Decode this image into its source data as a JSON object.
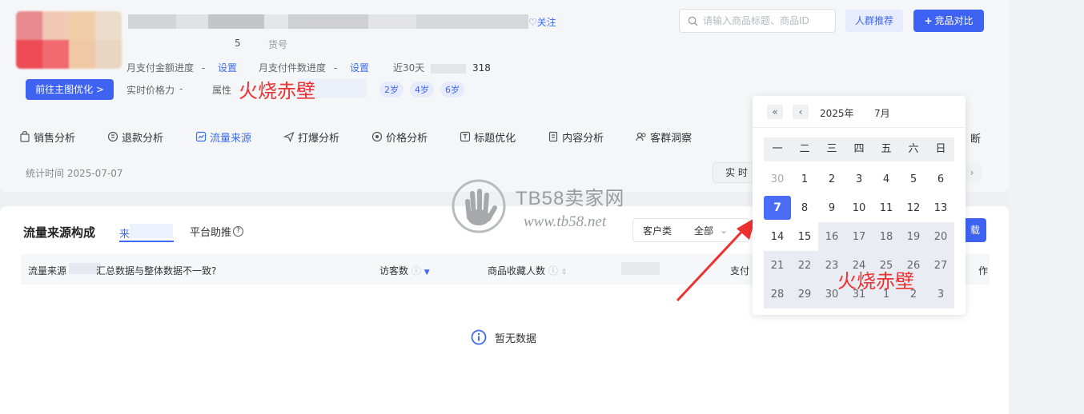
{
  "header": {
    "follow_label": "关注",
    "shop_suffix_num": "5",
    "shop_suffix_label": "货号",
    "optimize_button": "前往主图优化 >",
    "stats": [
      {
        "label": "月支付金额进度",
        "sep": "-",
        "link": "设置"
      },
      {
        "label": "月支付件数进度",
        "sep": "-",
        "link": "设置"
      },
      {
        "label": "近30天",
        "value": "318"
      }
    ],
    "price_label": "实时价格力",
    "price_sep": "-",
    "attr_label": "属性",
    "ages": [
      "2岁",
      "4岁",
      "6岁"
    ]
  },
  "search": {
    "placeholder": "请输入商品标题、商品ID"
  },
  "toolbar": {
    "crowd_button": "人群推荐",
    "compare_button": "竞品对比"
  },
  "tabs": [
    {
      "label": "销售分析",
      "icon": "bag-icon"
    },
    {
      "label": "退款分析",
      "icon": "refund-icon"
    },
    {
      "label": "流量来源",
      "icon": "trend-icon",
      "active": true
    },
    {
      "label": "打爆分析",
      "icon": "send-icon"
    },
    {
      "label": "价格分析",
      "icon": "price-icon"
    },
    {
      "label": "标题优化",
      "icon": "title-icon"
    },
    {
      "label": "内容分析",
      "icon": "doc-icon"
    },
    {
      "label": "客群洞察",
      "icon": "users-icon"
    }
  ],
  "tab_overflow_fragment": "断",
  "stat_time": "统计时间 2025-07-07",
  "realtime_label": "实 时",
  "section": {
    "title": "流量来源构成",
    "tab_source": "来",
    "tab_platform": "平台助推",
    "filter_label": "客户类",
    "filter_value": "全部",
    "download_fragment": "载"
  },
  "table": {
    "col_source": "流量来源",
    "col_hint": "汇总数据与整体数据不一致?",
    "col_visitors": "访客数",
    "col_favs": "商品收藏人数",
    "col_pay": "支付",
    "col_ops": "作"
  },
  "empty_text": "暂无数据",
  "watermark": {
    "brand": "TB58卖家网",
    "url": "www.tb58.net"
  },
  "annotation": {
    "text": "火烧赤壁",
    "text2": "火烧赤壁"
  },
  "calendar": {
    "year": "2025年",
    "month": "7月",
    "weekdays": [
      "一",
      "二",
      "三",
      "四",
      "五",
      "六",
      "日"
    ],
    "days": [
      {
        "d": "30",
        "t": "muted"
      },
      {
        "d": "1"
      },
      {
        "d": "2"
      },
      {
        "d": "3"
      },
      {
        "d": "4"
      },
      {
        "d": "5"
      },
      {
        "d": "6"
      },
      {
        "d": "7",
        "t": "sel"
      },
      {
        "d": "8"
      },
      {
        "d": "9"
      },
      {
        "d": "10"
      },
      {
        "d": "11"
      },
      {
        "d": "12"
      },
      {
        "d": "13"
      },
      {
        "d": "14"
      },
      {
        "d": "15"
      },
      {
        "d": "16",
        "t": "range"
      },
      {
        "d": "17",
        "t": "range"
      },
      {
        "d": "18",
        "t": "range"
      },
      {
        "d": "19",
        "t": "range"
      },
      {
        "d": "20",
        "t": "range"
      },
      {
        "d": "21",
        "t": "range"
      },
      {
        "d": "22",
        "t": "range"
      },
      {
        "d": "23",
        "t": "range"
      },
      {
        "d": "24",
        "t": "range"
      },
      {
        "d": "25",
        "t": "range"
      },
      {
        "d": "26",
        "t": "range"
      },
      {
        "d": "27",
        "t": "range"
      },
      {
        "d": "28",
        "t": "range"
      },
      {
        "d": "29",
        "t": "range"
      },
      {
        "d": "30",
        "t": "range"
      },
      {
        "d": "31",
        "t": "range"
      },
      {
        "d": "1",
        "t": "range"
      },
      {
        "d": "2",
        "t": "range"
      },
      {
        "d": "3",
        "t": "range"
      }
    ]
  },
  "colors": {
    "accent": "#3e63f3",
    "annotation": "#ee3131"
  }
}
